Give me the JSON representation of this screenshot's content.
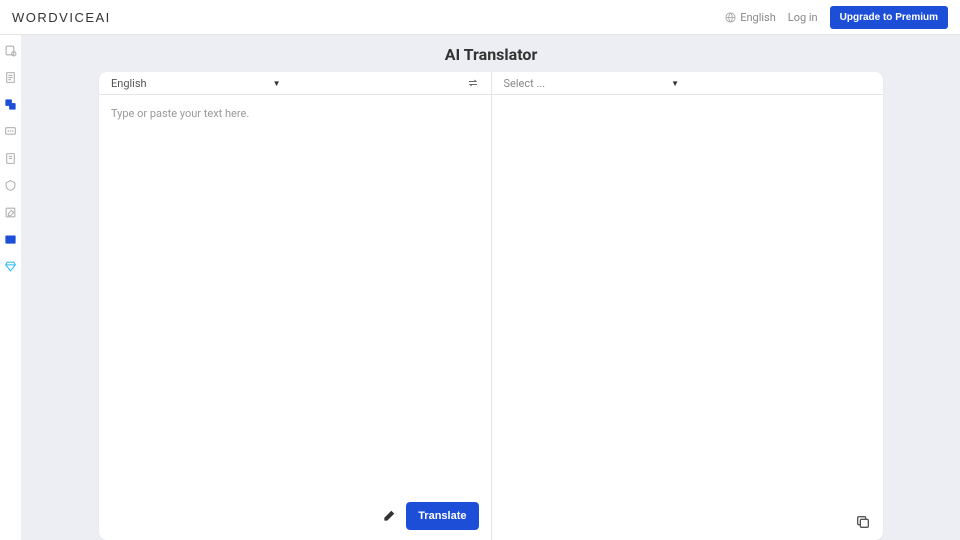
{
  "header": {
    "logo_main": "WORDVICE",
    "logo_suffix": "AI",
    "language": "English",
    "login": "Log in",
    "upgrade": "Upgrade to Premium"
  },
  "page": {
    "title": "AI Translator"
  },
  "translator": {
    "source_lang": "English",
    "target_lang": "Select ...",
    "input_placeholder": "Type or paste your text here.",
    "translate_button": "Translate"
  }
}
